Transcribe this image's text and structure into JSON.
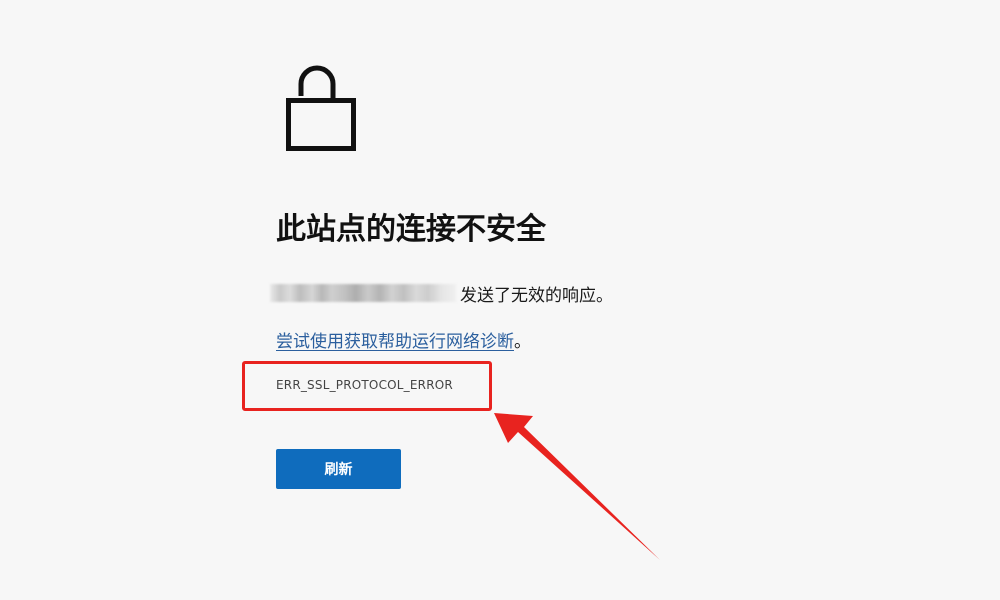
{
  "error_page": {
    "title": "此站点的连接不安全",
    "message_suffix": "发送了无效的响应。",
    "diagnostics_link": "尝试使用获取帮助运行网络诊断",
    "diagnostics_period": "。",
    "error_code": "ERR_SSL_PROTOCOL_ERROR",
    "refresh_label": "刷新"
  },
  "icons": {
    "lock": "unlocked-padlock-icon"
  },
  "colors": {
    "background": "#f7f7f7",
    "link": "#2b5f9e",
    "button": "#0f6cbd",
    "annotation": "#e8231f"
  }
}
